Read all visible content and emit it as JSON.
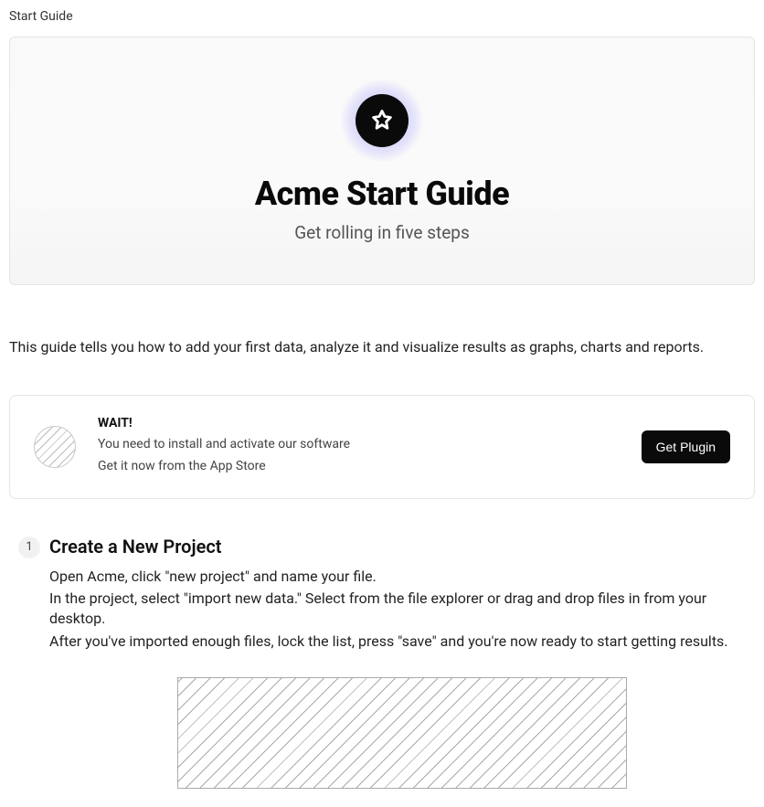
{
  "breadcrumb": "Start Guide",
  "hero": {
    "title": "Acme Start Guide",
    "subtitle": "Get rolling in five steps"
  },
  "intro": "This guide tells you how to add your first data, analyze it and visualize results as graphs, charts and reports.",
  "callout": {
    "title": "WAIT!",
    "line1": "You need to install and activate our software",
    "line2": "Get it now from the App Store",
    "button": "Get Plugin"
  },
  "step1": {
    "number": "1",
    "title": "Create a New Project",
    "para1": "Open Acme, click \"new project\" and name your file.",
    "para2": "In the project, select \"import new data.\" Select from the file explorer or drag and drop files in from your desktop.",
    "para3": "After you've imported enough files, lock the list, press \"save\" and you're now ready to start getting results."
  }
}
